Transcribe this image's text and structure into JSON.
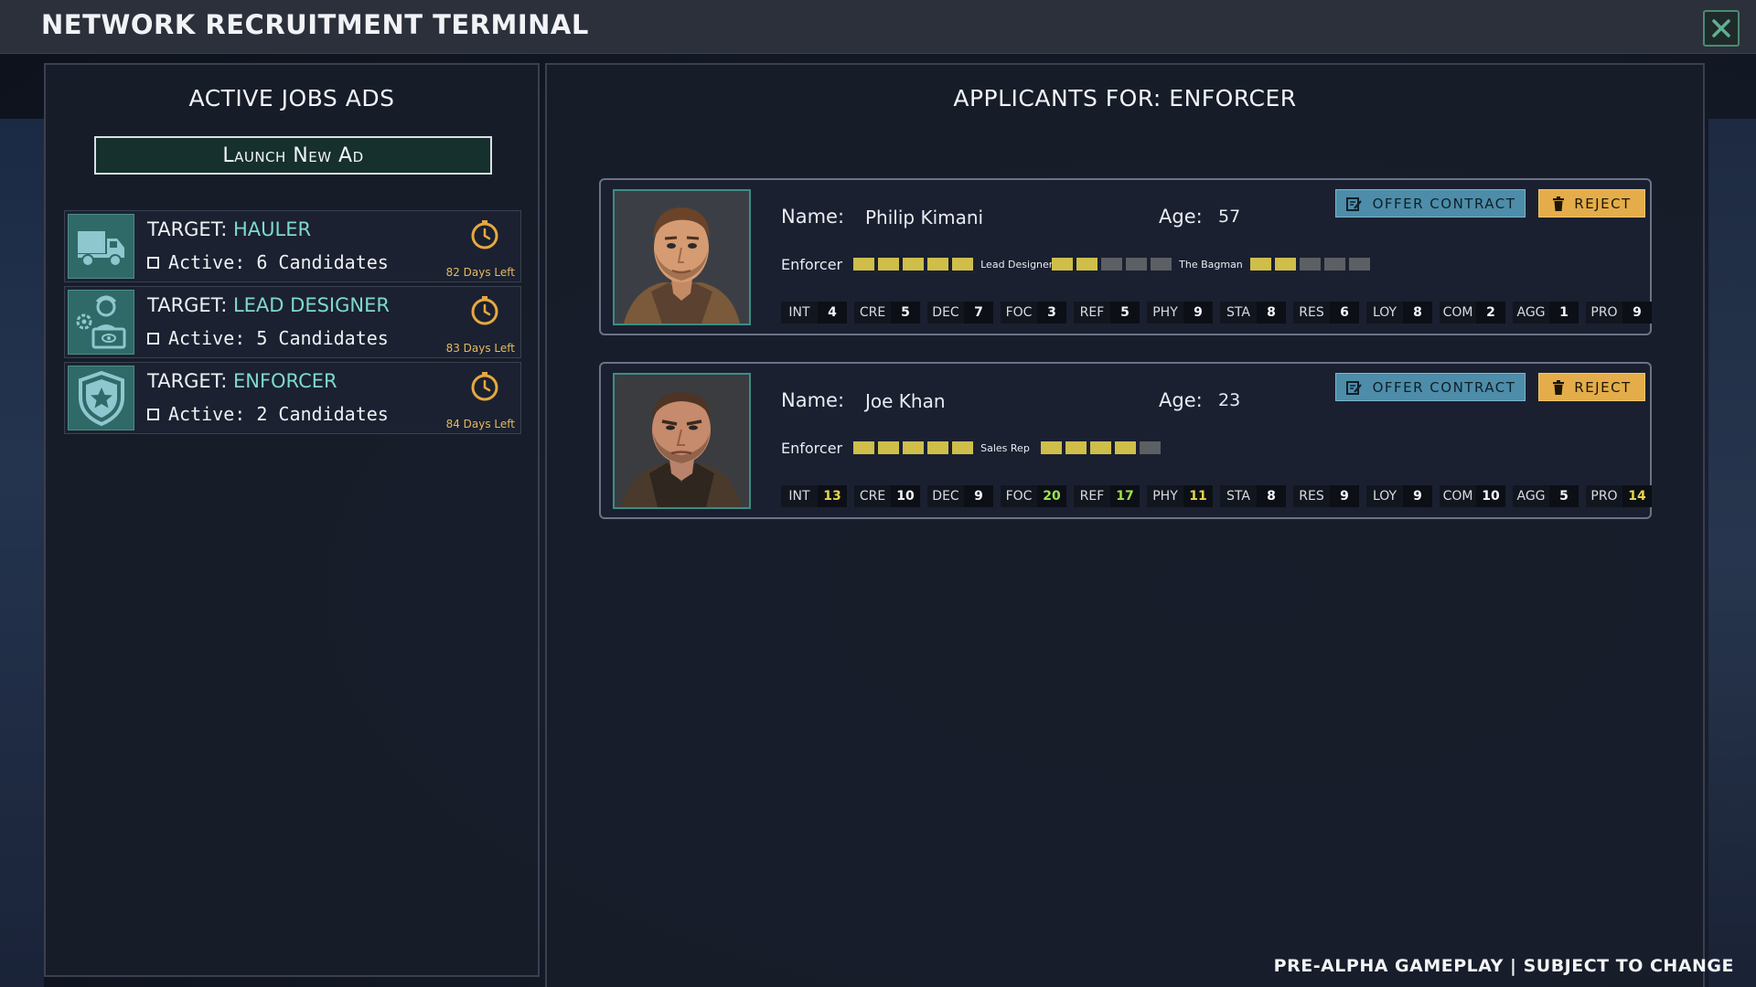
{
  "window": {
    "title": "NETWORK RECRUITMENT TERMINAL"
  },
  "left_panel": {
    "heading": "ACTIVE JOBS ADS",
    "launch_label": "Launch New Ad",
    "jobs": [
      {
        "target_prefix": "TARGET: ",
        "role": "HAULER",
        "active": "Active: 6 Candidates",
        "days_left": "82 Days Left",
        "icon": "truck-icon"
      },
      {
        "target_prefix": "TARGET: ",
        "role": "LEAD DESIGNER",
        "active": "Active: 5 Candidates",
        "days_left": "83 Days Left",
        "icon": "designer-gear-icon"
      },
      {
        "target_prefix": "TARGET: ",
        "role": "ENFORCER",
        "active": "Active: 2 Candidates",
        "days_left": "84 Days Left",
        "icon": "shield-star-icon"
      }
    ]
  },
  "right_panel": {
    "heading": "APPLICANTS FOR: ENFORCER",
    "name_label": "Name:",
    "age_label": "Age:",
    "offer_label": "OFFER CONTRACT",
    "reject_label": "REJECT",
    "applicants": [
      {
        "name": "Philip Kimani",
        "age": "57",
        "skills": [
          {
            "name": "Enforcer",
            "level": 5,
            "max": 5
          },
          {
            "name": "Lead Designer",
            "level": 2,
            "max": 5
          },
          {
            "name": "The Bagman",
            "level": 2,
            "max": 5
          }
        ],
        "stats": [
          {
            "label": "INT",
            "value": "4"
          },
          {
            "label": "CRE",
            "value": "5"
          },
          {
            "label": "DEC",
            "value": "7"
          },
          {
            "label": "FOC",
            "value": "3"
          },
          {
            "label": "REF",
            "value": "5"
          },
          {
            "label": "PHY",
            "value": "9"
          },
          {
            "label": "STA",
            "value": "8"
          },
          {
            "label": "RES",
            "value": "6"
          },
          {
            "label": "LOY",
            "value": "8"
          },
          {
            "label": "COM",
            "value": "2"
          },
          {
            "label": "AGG",
            "value": "1"
          },
          {
            "label": "PRO",
            "value": "9"
          }
        ]
      },
      {
        "name": "Joe Khan",
        "age": "23",
        "skills": [
          {
            "name": "Enforcer",
            "level": 5,
            "max": 5
          },
          {
            "name": "Sales Rep",
            "level": 4,
            "max": 5
          }
        ],
        "stats": [
          {
            "label": "INT",
            "value": "13",
            "tier": "top"
          },
          {
            "label": "CRE",
            "value": "10"
          },
          {
            "label": "DEC",
            "value": "9"
          },
          {
            "label": "FOC",
            "value": "20",
            "tier": "high"
          },
          {
            "label": "REF",
            "value": "17",
            "tier": "high"
          },
          {
            "label": "PHY",
            "value": "11",
            "tier": "top"
          },
          {
            "label": "STA",
            "value": "8"
          },
          {
            "label": "RES",
            "value": "9"
          },
          {
            "label": "LOY",
            "value": "9"
          },
          {
            "label": "COM",
            "value": "10"
          },
          {
            "label": "AGG",
            "value": "5"
          },
          {
            "label": "PRO",
            "value": "14",
            "tier": "top"
          }
        ]
      }
    ]
  },
  "footer": {
    "note": "PRE-ALPHA GAMEPLAY | SUBJECT TO CHANGE"
  },
  "colors": {
    "accent": "#7ed9cf",
    "offer": "#4d8da9",
    "reject": "#e4ad4a",
    "skill_on": "#cfbe4a",
    "timer": "#e6a940"
  }
}
